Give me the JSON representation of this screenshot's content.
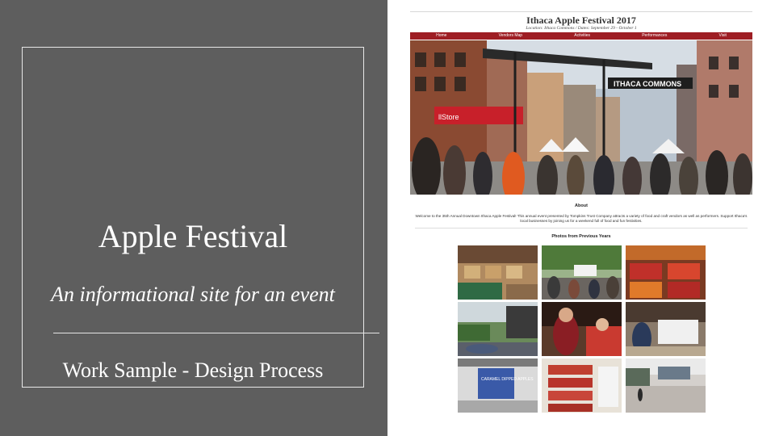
{
  "slide": {
    "title": "Apple Festival",
    "subtitle": "An informational site for an event",
    "tagline": "Work Sample - Design Process"
  },
  "site": {
    "title": "Ithaca Apple Festival 2017",
    "meta": "Location: Ithaca Commons / Dates: September 29 - October 1",
    "nav": [
      "Home",
      "Vendors Map",
      "Activities",
      "Performances",
      "Visit"
    ],
    "hero_sign": "ITHACA COMMONS",
    "hero_store_sign": "llStore",
    "about_heading": "About",
    "about_text": "Welcome to the 35th Annual Downtown Ithaca Apple Festival! This annual event presented by Tompkins Trust Company attracts a variety of food and craft vendors as well as performers. Support Ithaca's local businesses by joining us for a weekend full of food and fun festivities.",
    "photos_heading": "Photos from Previous Years",
    "photo_sign": "CARAMEL DIPPED APPLES"
  },
  "colors": {
    "slide_panel": "#5e5e5e",
    "nav_bar": "#9e1e24"
  }
}
